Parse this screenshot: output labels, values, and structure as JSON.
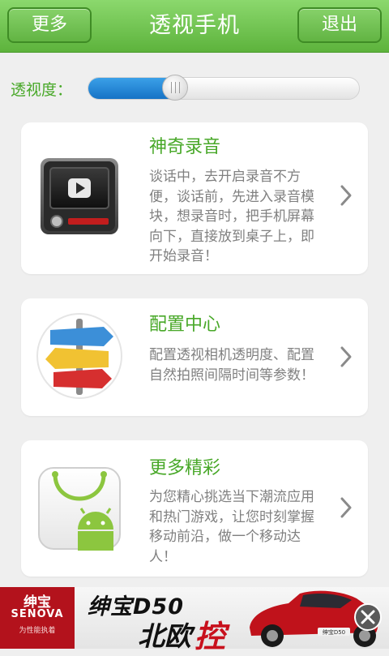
{
  "header": {
    "more_label": "更多",
    "title": "透视手机",
    "exit_label": "退出"
  },
  "transparency": {
    "label": "透视度：",
    "value_fraction": 0.32
  },
  "features": [
    {
      "icon": "video-player-icon",
      "title": "神奇录音",
      "description": "谈话中，去开启录音不方便，谈话前，先进入录音模块，想录音时，把手机屏幕向下，直接放到桌子上，即开始录音！"
    },
    {
      "icon": "signpost-icon",
      "title": "配置中心",
      "description": "配置透视相机透明度、配置自然拍照间隔时间等参数！"
    },
    {
      "icon": "android-bag-icon",
      "title": "更多精彩",
      "description": "为您精心挑选当下潮流应用和热门游戏，让您时刻掌握移动前沿，做一个移动达人！"
    }
  ],
  "ad": {
    "logo_cn": "绅宝",
    "logo_en": "SENOVA",
    "logo_sub": "为性能执着",
    "headline": "绅宝D50",
    "tagline_black": "北欧",
    "tagline_red": "控",
    "car_plate": "绅宝D50"
  },
  "colors": {
    "header_green": "#62b443",
    "accent_green": "#48a828",
    "slider_blue": "#1673c6",
    "ad_red": "#c8101c"
  }
}
